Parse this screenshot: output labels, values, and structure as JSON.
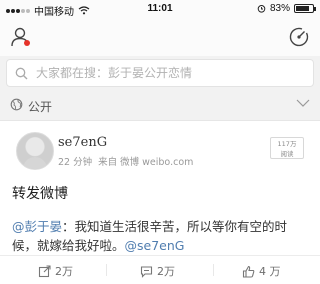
{
  "status_bar": {
    "carrier": "中国移动",
    "time": "11:01",
    "battery_text": "83%",
    "battery_level": 0.83
  },
  "nav": {
    "icons": [
      "profile-icon",
      "radar-icon"
    ]
  },
  "search": {
    "placeholder": "大家都在搜：彭于晏公开恋情"
  },
  "group": {
    "label": "公开"
  },
  "post": {
    "username": "se7enG",
    "time_ago": "22 分钟",
    "source": "来自 微博 weibo.com",
    "read_badge_count": "117万",
    "read_badge_label": "阅读",
    "title": "转发微博",
    "mention": "@彭于晏",
    "body": "：我知道生活很辛苦，所以等你有空的时候，就嫁给我好啦。",
    "trailing_mention": "@se7enG"
  },
  "actions": {
    "repost_count": "2万",
    "comment_count": "2万",
    "like_count": "4  万"
  }
}
